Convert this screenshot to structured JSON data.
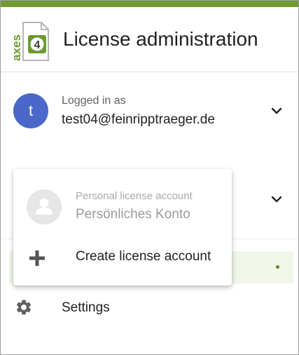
{
  "colors": {
    "accent_bar": "#6e9a2f",
    "avatar_user": "#4a68c9",
    "active_row": "#f1f6ea",
    "active_dot": "#5b8a2a"
  },
  "header": {
    "logo_text": "axes",
    "logo_number": "4",
    "title": "License administration"
  },
  "account": {
    "avatar_initial": "t",
    "logged_in_label": "Logged in as",
    "email": "test04@feinripptraeger.de",
    "expand_icon": "chevron-down-icon"
  },
  "account_selector": {
    "expand_icon": "chevron-down-icon"
  },
  "menu": {
    "items": [
      {
        "label": "Personal license account",
        "name": "Persönliches Konto",
        "icon": "person-avatar-icon"
      },
      {
        "label": "Create license account",
        "icon": "plus-icon"
      }
    ]
  },
  "settings": {
    "label": "Settings",
    "icon": "gear-icon"
  }
}
